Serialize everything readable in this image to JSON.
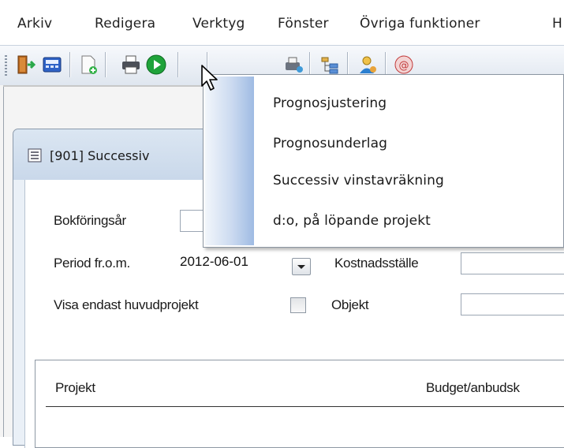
{
  "menubar": {
    "items": [
      "Arkiv",
      "Redigera",
      "Verktyg",
      "Fönster",
      "Övriga funktioner",
      "H"
    ]
  },
  "toolbar": {
    "icons": [
      "exit-door-icon",
      "calculator-icon",
      "new-document-icon",
      "print-icon",
      "run-green-icon",
      "printer-setup-icon",
      "tree-icon",
      "user-icon",
      "email-icon"
    ]
  },
  "child_window": {
    "title": "[901]  Successiv",
    "fields": {
      "bokforingsar_label": "Bokföringsår",
      "bokforingsar_value": "",
      "period_label": "Period fr.o.m.",
      "period_value": "2012-06-01",
      "kostnadsstalle_label": "Kostnadsställe",
      "kostnadsstalle_value": "",
      "visa_label": "Visa endast huvudprojekt",
      "visa_checked": false,
      "objekt_label": "Objekt",
      "objekt_value": ""
    },
    "grid": {
      "columns": [
        "Projekt",
        "Budget/anbudsk"
      ]
    }
  },
  "popup_menu": {
    "items": [
      "Prognosjustering",
      "Prognosunderlag",
      "Successiv vinstavräkning",
      "d:o, på löpande projekt"
    ]
  },
  "colors": {
    "toolbar_bg": "#dfe6ef",
    "title_bg": "#c9d8ea",
    "menu_strip": "#9fbbe3"
  }
}
